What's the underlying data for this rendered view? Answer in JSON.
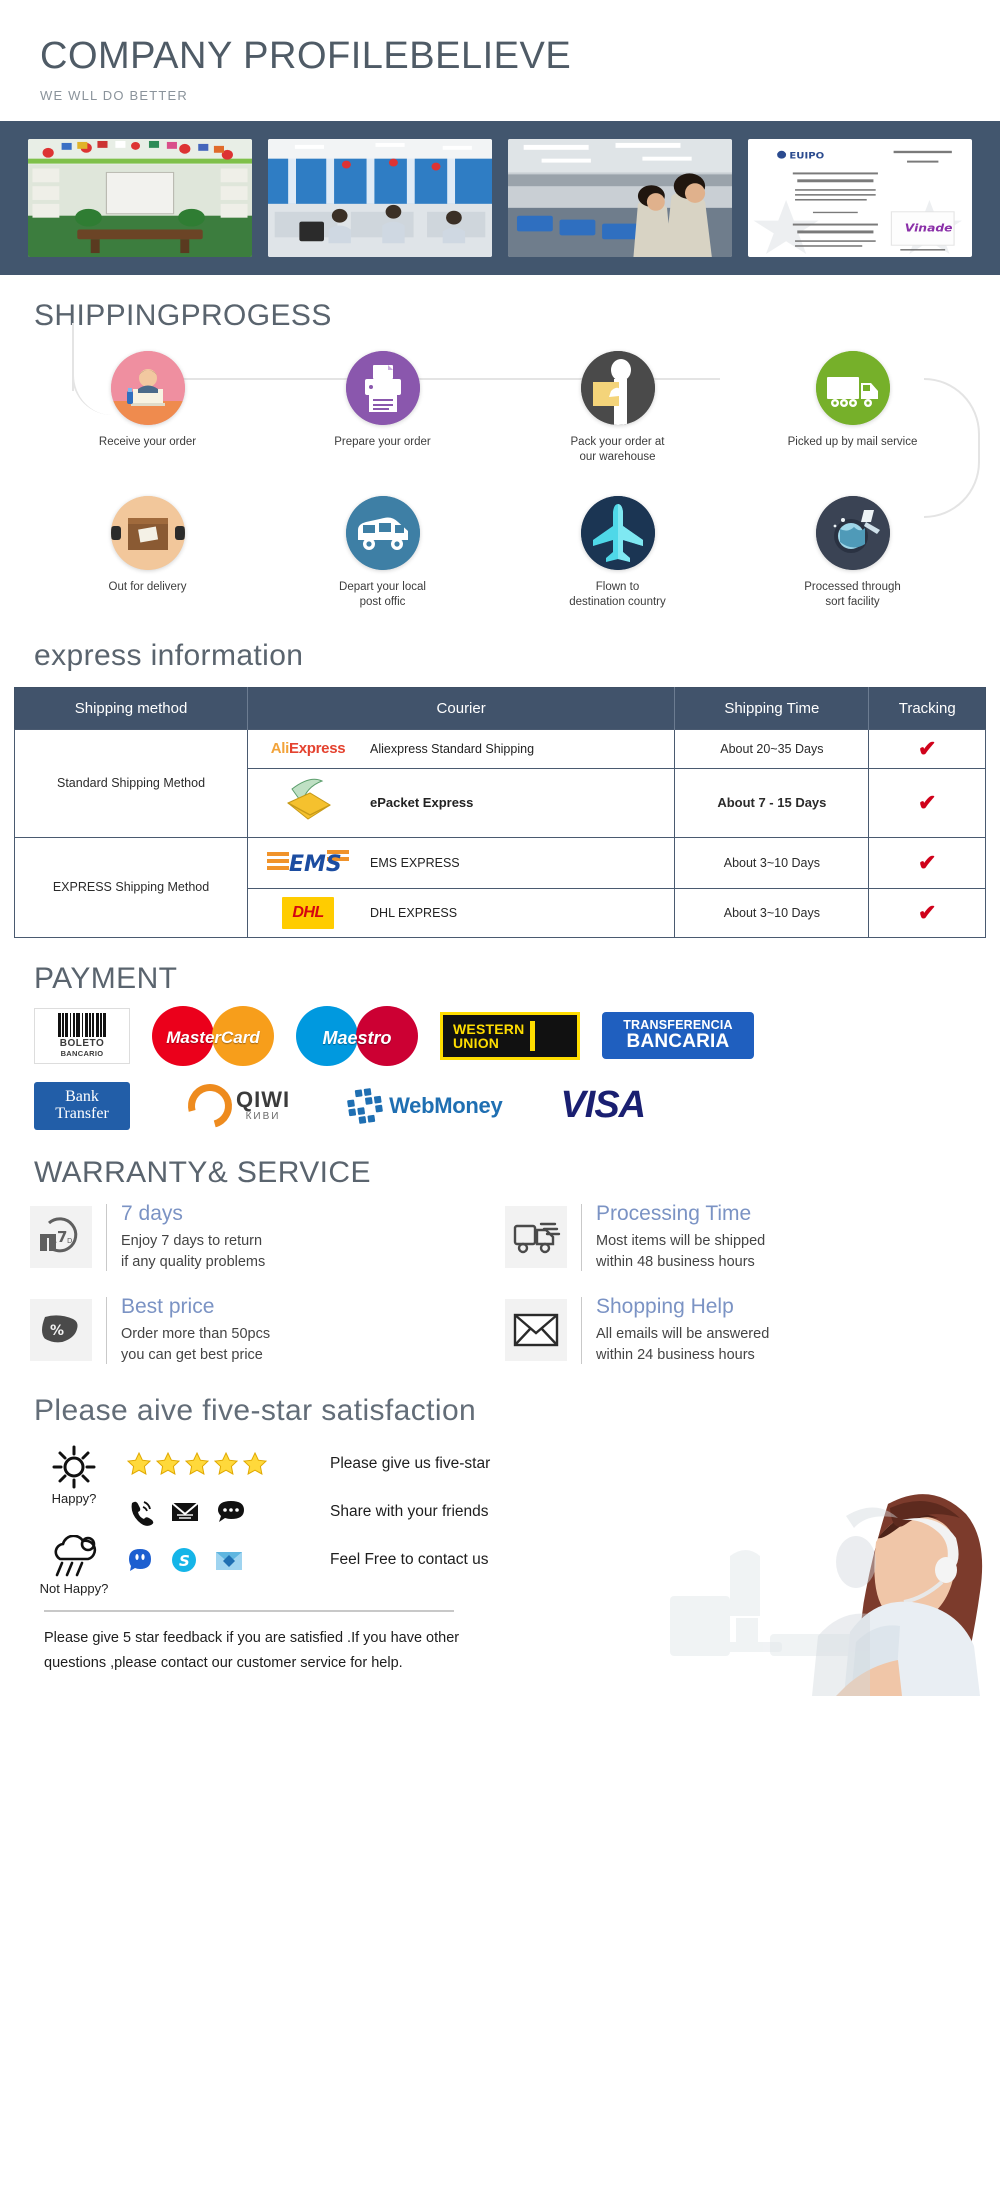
{
  "header": {
    "title": "COMPANY PROFILEBELIEVE",
    "subtitle": "WE WLL DO BETTER",
    "photos": [
      {
        "name": "showroom-photo",
        "alt": "Showroom with flags and projector screen"
      },
      {
        "name": "office-photo",
        "alt": "Open plan office with staff at computers"
      },
      {
        "name": "factory-photo",
        "alt": "Workers at production line"
      },
      {
        "name": "certificate-photo",
        "alt": "EUIPO certificate of registration"
      }
    ]
  },
  "shipping_progress": {
    "title": "SHIPPINGPROGESS",
    "steps_row1": [
      {
        "label": "Receive your order",
        "icon": "customer-service-icon",
        "color": "#ef8fa0"
      },
      {
        "label": "Prepare your order",
        "icon": "printer-icon",
        "color": "#8a57ad"
      },
      {
        "label": "Pack your order at\nour warehouse",
        "icon": "packing-worker-icon",
        "color": "#4a4a4a"
      },
      {
        "label": "Picked up by mail service",
        "icon": "truck-icon",
        "color": "#76b02a"
      }
    ],
    "steps_row2": [
      {
        "label": "Out for delivery",
        "icon": "parcel-box-icon",
        "color": "#f2c79b"
      },
      {
        "label": "Depart your local\npost offic",
        "icon": "van-icon",
        "color": "#3e7fa5"
      },
      {
        "label": "Flown to\ndestination country",
        "icon": "airplane-icon",
        "color": "#1b3553"
      },
      {
        "label": "Processed through\nsort facility",
        "icon": "globe-sort-icon",
        "color": "#3a4354"
      }
    ]
  },
  "express": {
    "title": "express information",
    "columns": [
      "Shipping method",
      "Courier",
      "Shipping Time",
      "Tracking"
    ],
    "groups": [
      {
        "method": "Standard Shipping Method",
        "rows": [
          {
            "logo": "aliexpress-logo",
            "courier": "Aliexpress Standard Shipping",
            "time": "About 20~35 Days",
            "tracking": "✔",
            "bold": false
          },
          {
            "logo": "epacket-logo",
            "courier": "ePacket Express",
            "time": "About 7 - 15 Days",
            "tracking": "✔",
            "bold": true
          }
        ]
      },
      {
        "method": "EXPRESS Shipping Method",
        "rows": [
          {
            "logo": "ems-logo",
            "courier": "EMS EXPRESS",
            "time": "About 3~10 Days",
            "tracking": "✔",
            "bold": false
          },
          {
            "logo": "dhl-logo",
            "courier": "DHL EXPRESS",
            "time": "About 3~10 Days",
            "tracking": "✔",
            "bold": false
          }
        ]
      }
    ],
    "logo_text": {
      "aliexpress_a": "Ali",
      "aliexpress_b": "Express",
      "ems": "EMS",
      "dhl": "DHL"
    }
  },
  "payment": {
    "title": "PAYMENT",
    "methods_row1": [
      {
        "name": "boleto-bancario-logo",
        "line1": "BOLETO",
        "line2": "BANCARIO"
      },
      {
        "name": "mastercard-logo",
        "label": "MasterCard"
      },
      {
        "name": "maestro-logo",
        "label": "Maestro"
      },
      {
        "name": "western-union-logo",
        "line1": "WESTERN",
        "line2": "UNION"
      },
      {
        "name": "transferencia-bancaria-logo",
        "line1": "TRANSFERENCIA",
        "line2": "BANCARIA"
      }
    ],
    "methods_row2": [
      {
        "name": "bank-transfer-logo",
        "line1": "Bank",
        "line2": "Transfer"
      },
      {
        "name": "qiwi-logo",
        "line1": "QIWI",
        "line2": "КИВИ"
      },
      {
        "name": "webmoney-logo",
        "label": "WebMoney"
      },
      {
        "name": "visa-logo",
        "label": "VISA"
      }
    ]
  },
  "warranty": {
    "title": "WARRANTY& SERVICE",
    "items": [
      {
        "icon": "seven-days-return-icon",
        "heading": "7 days",
        "line1": "Enjoy 7 days to return",
        "line2": "if any quality problems"
      },
      {
        "icon": "delivery-truck-icon",
        "heading": "Processing Time",
        "line1": "Most items will be shipped",
        "line2": "within 48 business hours"
      },
      {
        "icon": "discount-percent-icon",
        "heading": "Best price",
        "line1": "Order more than 50pcs",
        "line2": "you can get best price"
      },
      {
        "icon": "envelope-icon",
        "heading": "Shopping Help",
        "line1": "All emails will be answered",
        "line2": "within 24 business hours"
      }
    ]
  },
  "feedback": {
    "title": "Please aive five-star satisfaction",
    "moods": [
      {
        "icon": "sun-icon",
        "label": "Happy?"
      },
      {
        "icon": "rain-cloud-icon",
        "label": "Not Happy?"
      }
    ],
    "lines": [
      {
        "icons": [
          "star-icon",
          "star-icon",
          "star-icon",
          "star-icon",
          "star-icon"
        ],
        "text": "Please give us five-star"
      },
      {
        "icons": [
          "phone-icon",
          "mail-icon",
          "chat-icon"
        ],
        "text": "Share with your friends"
      },
      {
        "icons": [
          "messenger-icon",
          "skype-icon",
          "email-blue-icon"
        ],
        "text": "Feel Free to contact us"
      }
    ],
    "footer_line1": "Please give 5 star feedback if you are satisfied .If you have other",
    "footer_line2": "questions ,please contact our customer service for help.",
    "photo": {
      "name": "call-center-agent-photo",
      "alt": "Woman with headset at computer"
    }
  },
  "colors": {
    "band": "#42566e",
    "table_header": "#41536b",
    "heading": "#5a646e",
    "accent_blue": "#7b93c4",
    "check_red": "#d0021b"
  }
}
